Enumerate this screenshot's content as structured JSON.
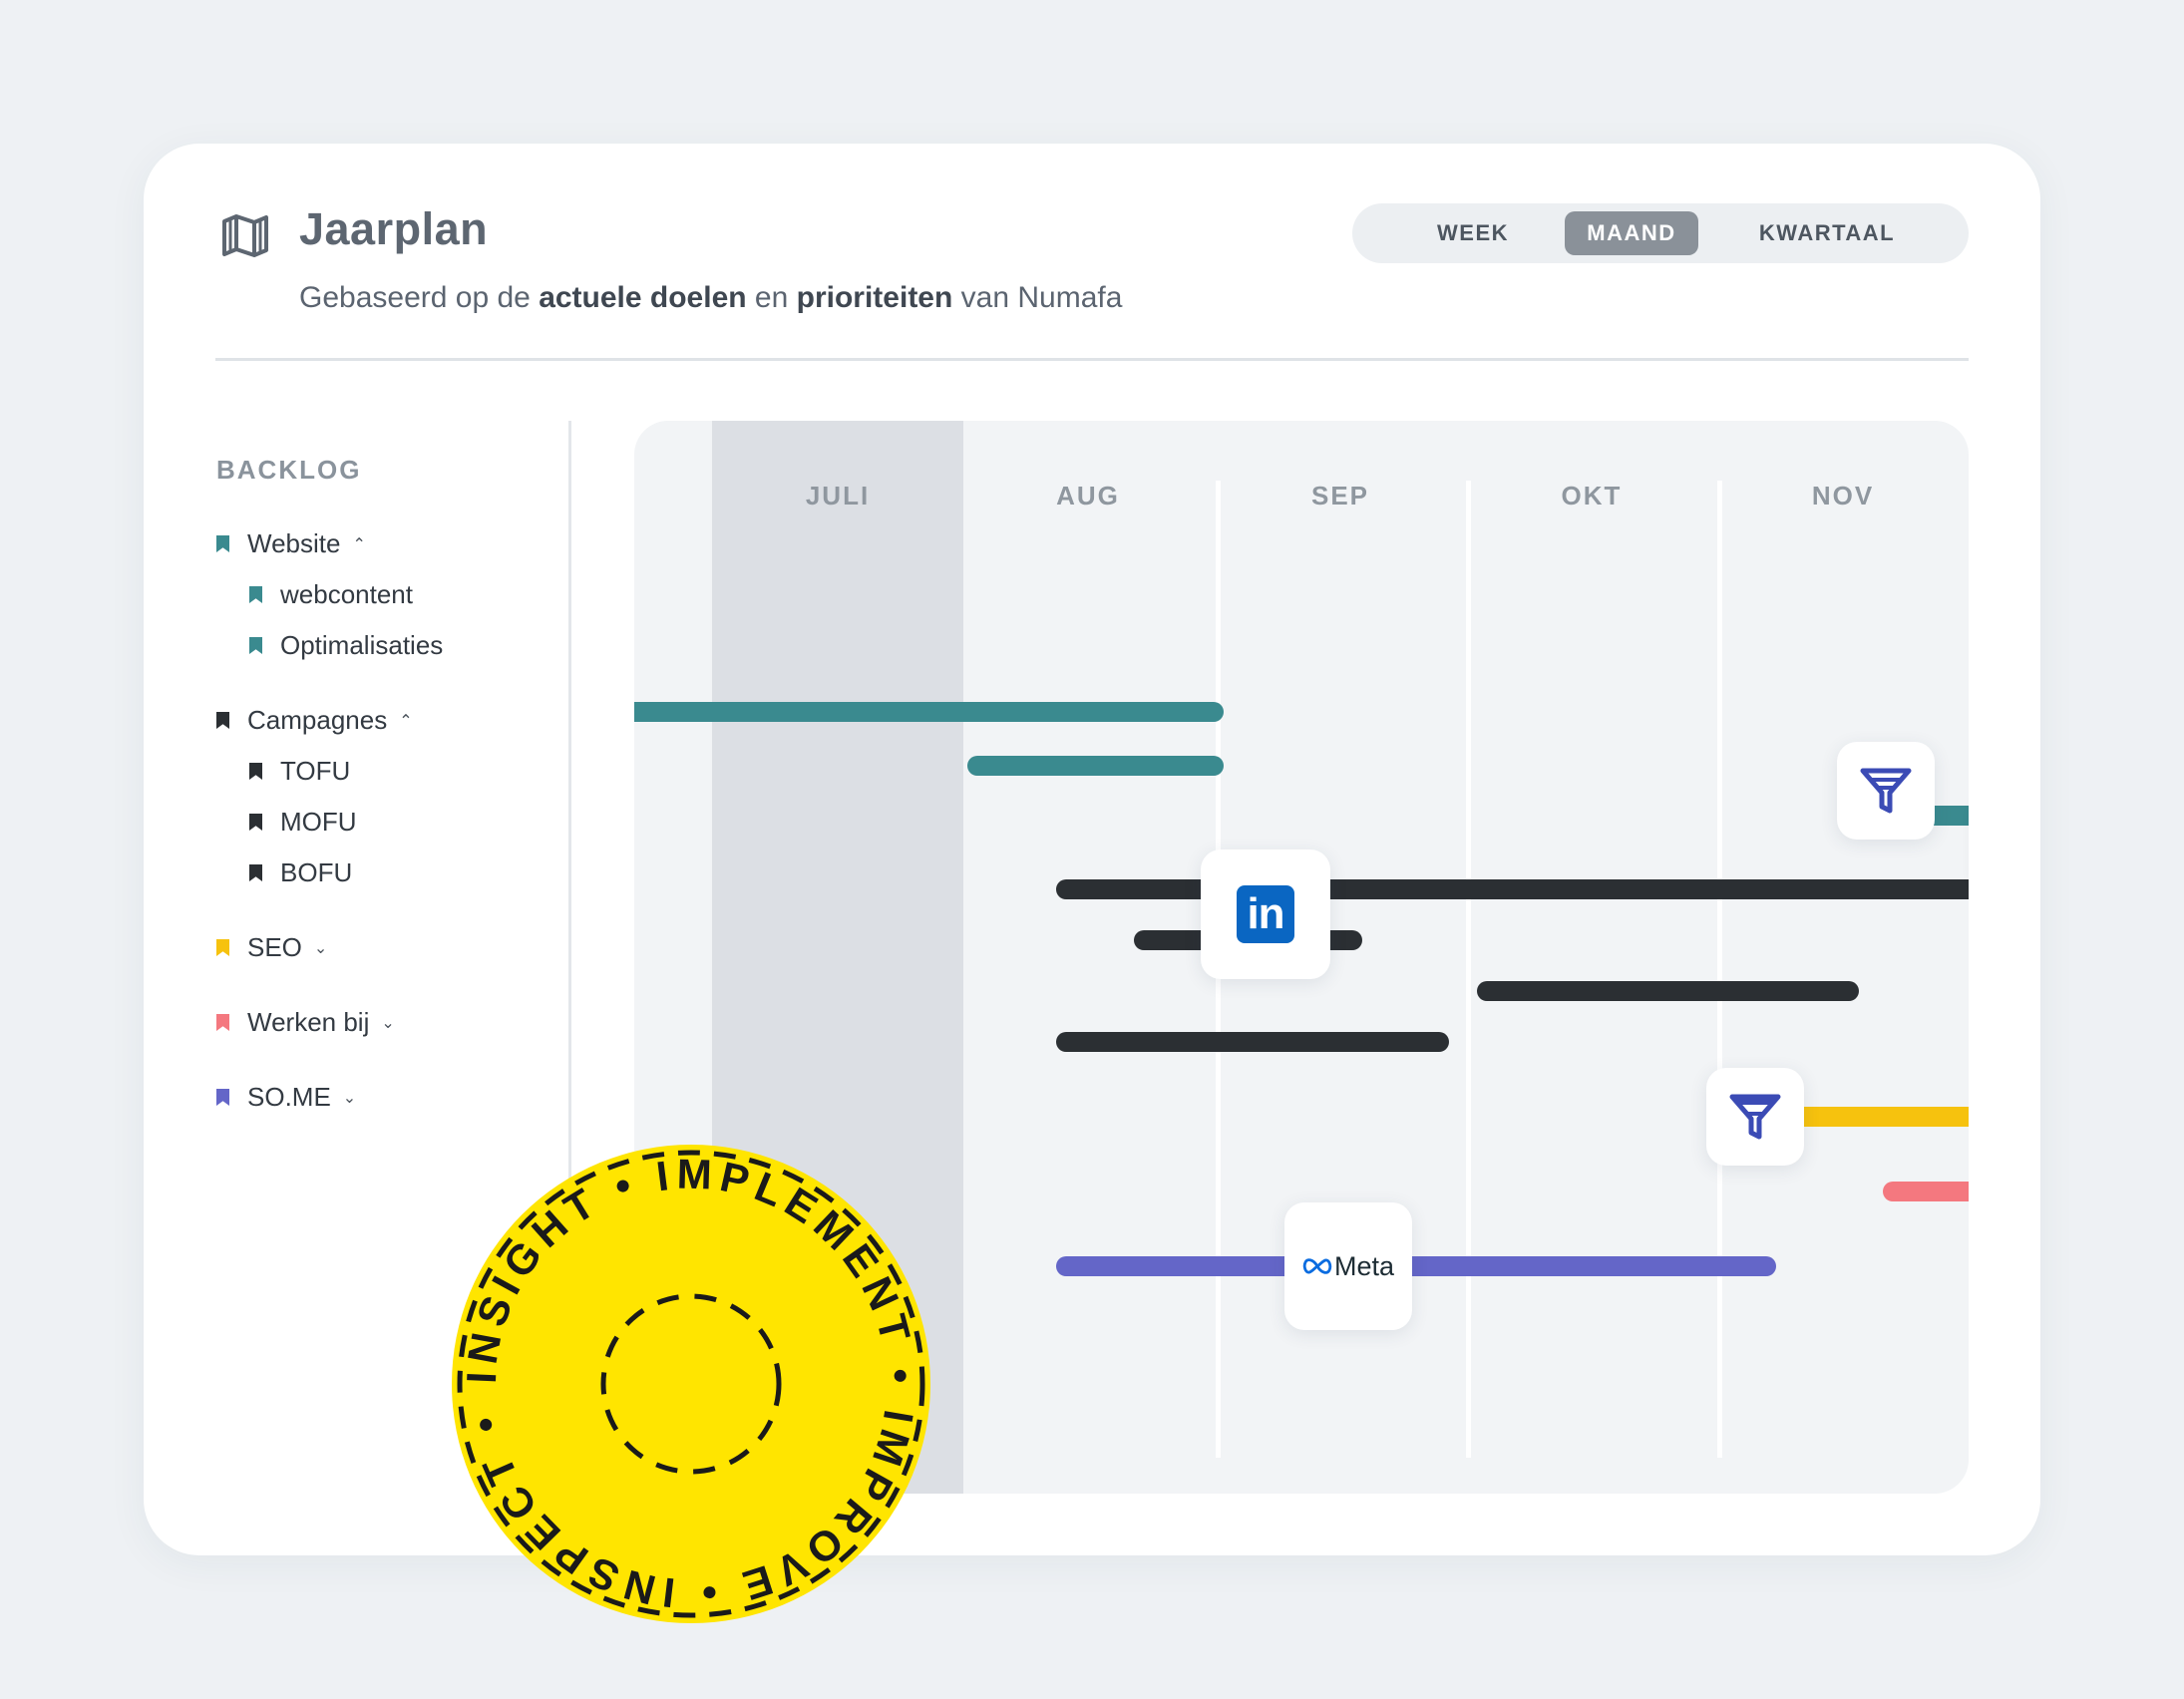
{
  "header": {
    "title": "Jaarplan",
    "subtitle": {
      "part1": "Gebaseerd op de ",
      "bold1": "actuele doelen",
      "part2": " en ",
      "bold2": "prioriteiten",
      "part3": " van Numafa"
    },
    "view_toggle": {
      "options": [
        "WEEK",
        "MAAND",
        "KWARTAAL"
      ],
      "selected": "MAAND"
    }
  },
  "backlog": {
    "title": "BACKLOG",
    "groups": [
      {
        "label": "Website",
        "color": "#3a8a8f",
        "expanded": true,
        "children": [
          "webcontent",
          "Optimalisaties"
        ]
      },
      {
        "label": "Campagnes",
        "color": "#2b2f33",
        "expanded": true,
        "children": [
          "TOFU",
          "MOFU",
          "BOFU"
        ]
      },
      {
        "label": "SEO",
        "color": "#f6c20e",
        "expanded": false,
        "children": []
      },
      {
        "label": "Werken bij",
        "color": "#f4787f",
        "expanded": false,
        "children": []
      },
      {
        "label": "SO.ME",
        "color": "#6466c8",
        "expanded": false,
        "children": []
      }
    ]
  },
  "timeline": {
    "months": [
      "JULI",
      "AUG",
      "SEP",
      "OKT",
      "NOV"
    ],
    "highlighted_month": "JULI",
    "icons": {
      "linkedin": "in",
      "meta": "Meta",
      "funnel": "funnel-icon",
      "mail": "mail-notification-icon"
    }
  },
  "sticker": {
    "text": "INSIGHT • IMPLEMENT • IMPROVE • INSPECT •",
    "color": "#ffe500"
  }
}
